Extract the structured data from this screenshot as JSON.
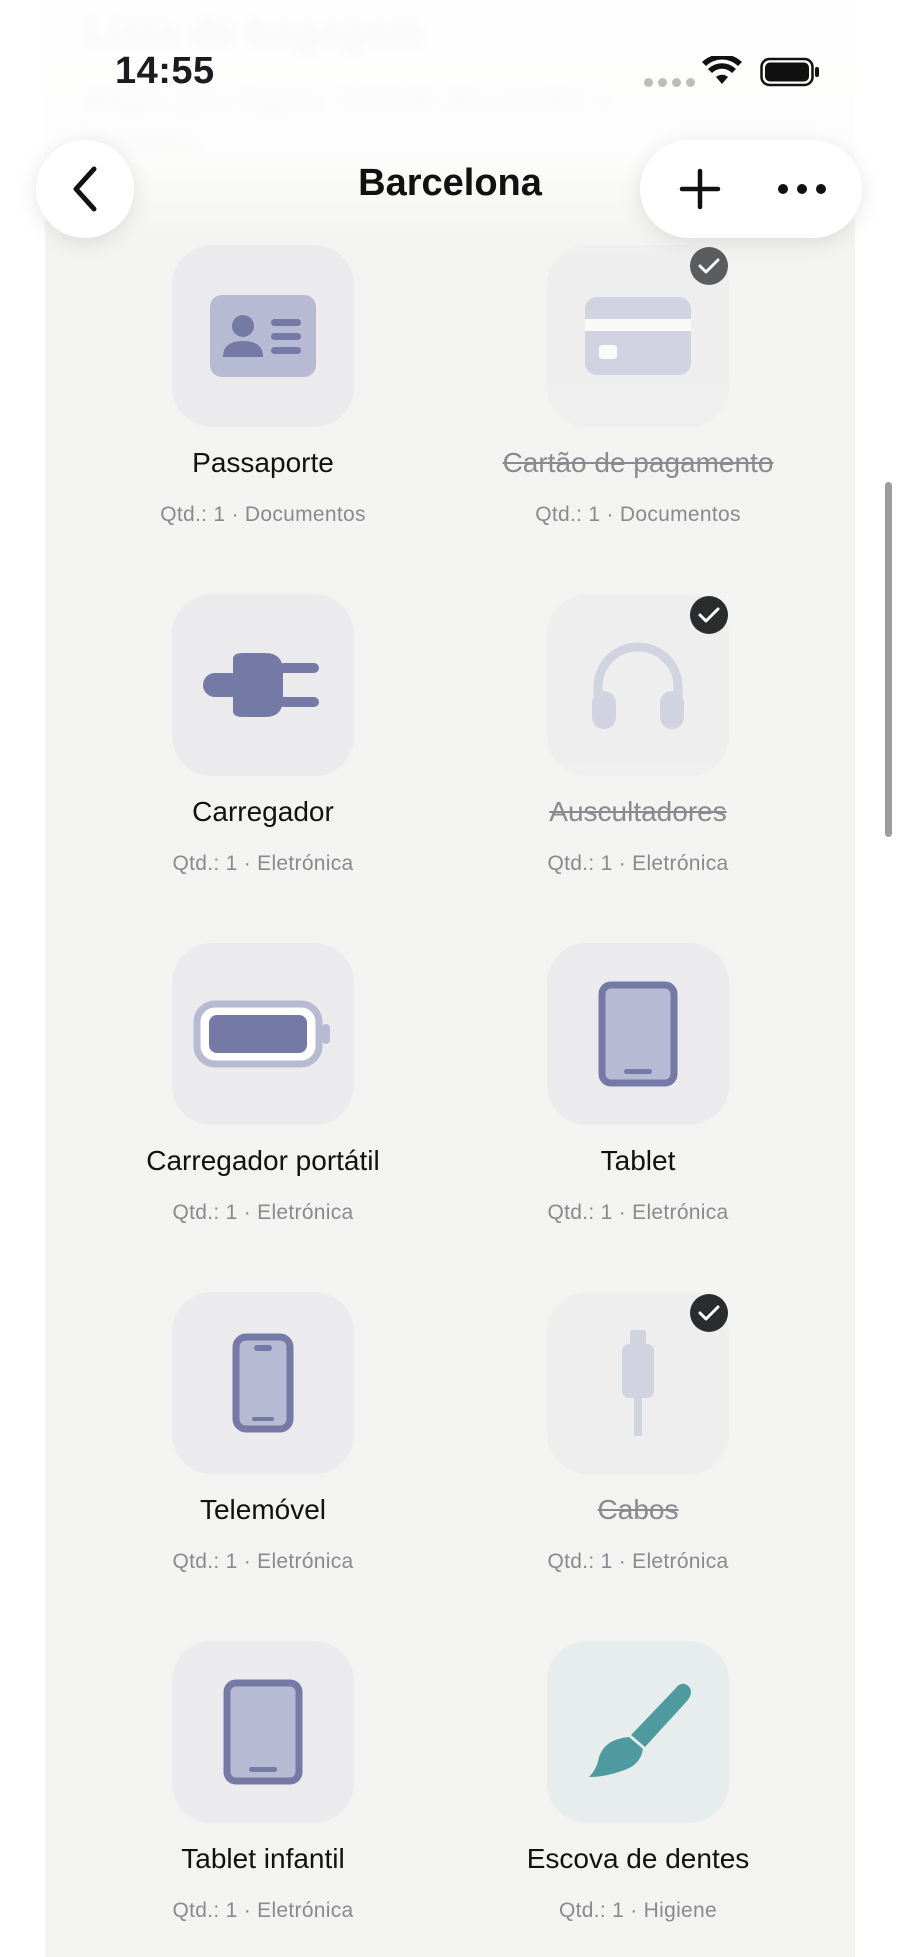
{
  "background_header": {
    "title": "Lista de bagagem",
    "subtitle": "Artigos para viagens, incluindo documentos e eletrónica"
  },
  "status_bar": {
    "time": "14:55"
  },
  "nav": {
    "title": "Barcelona"
  },
  "colors": {
    "icon": "#7479a6",
    "icon_light": "#b7bad3",
    "teal": "#4f9a9f",
    "check": "#2b2c2e"
  },
  "items": [
    {
      "name": "Passaporte",
      "meta": "Qtd.: 1 · Documentos",
      "icon": "id-card-icon",
      "checked": false
    },
    {
      "name": "Cartão de pagamento",
      "meta": "Qtd.: 1 · Documentos",
      "icon": "credit-card-icon",
      "checked": true
    },
    {
      "name": "Carregador",
      "meta": "Qtd.: 1 · Eletrónica",
      "icon": "plug-icon",
      "checked": false
    },
    {
      "name": "Auscultadores",
      "meta": "Qtd.: 1 · Eletrónica",
      "icon": "headphones-icon",
      "checked": true
    },
    {
      "name": "Carregador portátil",
      "meta": "Qtd.: 1 · Eletrónica",
      "icon": "battery-icon",
      "checked": false
    },
    {
      "name": "Tablet",
      "meta": "Qtd.: 1 · Eletrónica",
      "icon": "tablet-icon",
      "checked": false
    },
    {
      "name": "Telemóvel",
      "meta": "Qtd.: 1 · Eletrónica",
      "icon": "phone-icon",
      "checked": false
    },
    {
      "name": "Cabos",
      "meta": "Qtd.: 1 · Eletrónica",
      "icon": "cable-icon",
      "checked": true
    },
    {
      "name": "Tablet infantil",
      "meta": "Qtd.: 1 · Eletrónica",
      "icon": "tablet-icon",
      "checked": false
    },
    {
      "name": "Escova de dentes",
      "meta": "Qtd.: 1 · Higiene",
      "icon": "toothbrush-icon",
      "checked": false
    }
  ]
}
